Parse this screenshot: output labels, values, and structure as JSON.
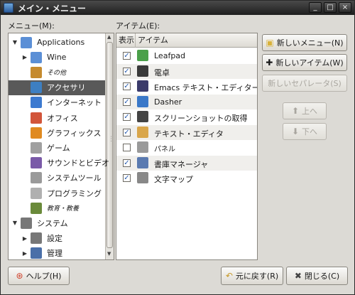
{
  "window": {
    "title": "メイン・メニュー",
    "buttons": {
      "minimize": "_",
      "maximize": "□",
      "close": "×"
    }
  },
  "menu_panel": {
    "label": "メニュー(M):"
  },
  "tree": [
    {
      "label": "Applications",
      "level": 0,
      "expander": "▼",
      "icon": "folder-icon",
      "color": "#5b8fd6"
    },
    {
      "label": "Wine",
      "level": 1,
      "expander": "▶",
      "icon": "folder-icon",
      "color": "#5b8fd6"
    },
    {
      "label": "その他",
      "level": 1,
      "small": true,
      "icon": "misc-icon",
      "color": "#c58a2e"
    },
    {
      "label": "アクセサリ",
      "level": 1,
      "selected": true,
      "icon": "accessories-icon",
      "color": "#3d7fc2"
    },
    {
      "label": "インターネット",
      "level": 1,
      "icon": "globe-icon",
      "color": "#3c7ad0"
    },
    {
      "label": "オフィス",
      "level": 1,
      "icon": "office-icon",
      "color": "#d2553a"
    },
    {
      "label": "グラフィックス",
      "level": 1,
      "icon": "graphics-icon",
      "color": "#e08a20"
    },
    {
      "label": "ゲーム",
      "level": 1,
      "icon": "games-icon",
      "color": "#a0a0a0"
    },
    {
      "label": "サウンドとビデオ",
      "level": 1,
      "icon": "multimedia-icon",
      "color": "#7a5aa8"
    },
    {
      "label": "システムツール",
      "level": 1,
      "icon": "system-tools-icon",
      "color": "#9a9a9a"
    },
    {
      "label": "プログラミング",
      "level": 1,
      "icon": "programming-icon",
      "color": "#b0b0b0"
    },
    {
      "label": "教育・教養",
      "level": 1,
      "small": true,
      "icon": "education-icon",
      "color": "#6a8a3a"
    },
    {
      "label": "システム",
      "level": 0,
      "expander": "▼",
      "icon": "system-icon",
      "color": "#777777"
    },
    {
      "label": "設定",
      "level": 1,
      "expander": "▶",
      "icon": "preferences-icon",
      "color": "#777777"
    },
    {
      "label": "管理",
      "level": 1,
      "expander": "▶",
      "icon": "admin-icon",
      "color": "#4a6fa8"
    }
  ],
  "items_panel": {
    "label": "アイテム(E):",
    "headers": {
      "show": "表示",
      "item": "アイテム"
    },
    "rows": [
      {
        "label": "Leafpad",
        "checked": true,
        "icon": "leafpad-icon",
        "color": "#4ba04a"
      },
      {
        "label": "電卓",
        "checked": true,
        "icon": "calculator-icon",
        "color": "#3a3a3a"
      },
      {
        "label": "Emacs テキスト・エディター",
        "checked": true,
        "icon": "emacs-icon",
        "color": "#3b3b6b"
      },
      {
        "label": "Dasher",
        "checked": true,
        "icon": "dasher-icon",
        "color": "#3a78c8"
      },
      {
        "label": "スクリーンショットの取得",
        "checked": true,
        "icon": "camera-icon",
        "color": "#444444"
      },
      {
        "label": "テキスト・エディタ",
        "checked": true,
        "icon": "text-editor-icon",
        "color": "#d9a64a"
      },
      {
        "label": "パネル",
        "checked": false,
        "small": true,
        "icon": "panel-icon",
        "color": "#9a9a9a"
      },
      {
        "label": "書庫マネージャ",
        "checked": true,
        "icon": "archive-icon",
        "color": "#5a7ab0"
      },
      {
        "label": "文字マップ",
        "checked": true,
        "icon": "charmap-icon",
        "color": "#888888"
      }
    ],
    "check_mark": "✓"
  },
  "side_buttons": {
    "new_menu": "新しいメニュー(N)",
    "new_item": "新しいアイテム(W)",
    "new_separator": "新しいセパレータ(S)",
    "up": "上へ",
    "down": "下へ"
  },
  "bottom_buttons": {
    "help": "ヘルプ(H)",
    "revert": "元に戻す(R)",
    "close": "閉じる(C)"
  }
}
